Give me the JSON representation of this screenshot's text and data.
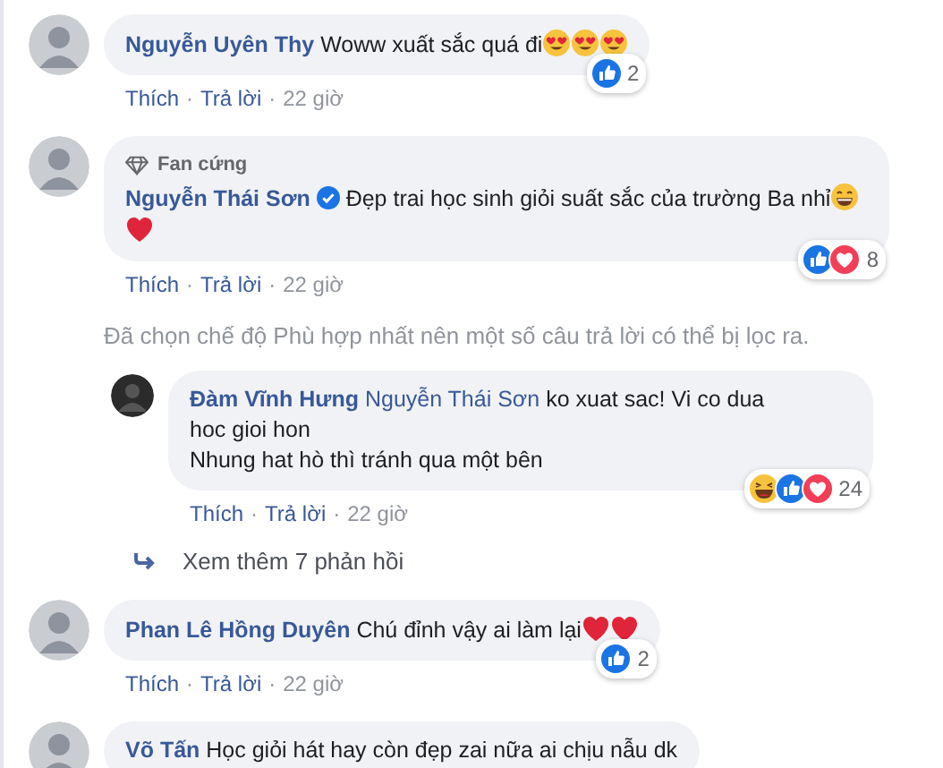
{
  "separator": "·",
  "comments": [
    {
      "name": "Nguyễn Uyên Thy",
      "verified": false,
      "text": "Woww xuất sắc quá đi",
      "emojis": [
        {
          "kind": "heart_eyes"
        },
        {
          "kind": "heart_eyes"
        },
        {
          "kind": "heart_eyes"
        }
      ],
      "reactions": {
        "kinds": [
          {
            "kind": "like"
          }
        ],
        "count": "2"
      },
      "actions": [
        "Thích",
        "Trả lời",
        "22 giờ"
      ]
    },
    {
      "name": "Nguyễn Thái Sơn",
      "badge": "Fan cứng",
      "verified": true,
      "text": "Đẹp trai học sinh giỏi suất sắc của trường Ba nhỉ",
      "emojis": [
        {
          "kind": "grin"
        },
        {
          "kind": "heart"
        }
      ],
      "reactions": {
        "kinds": [
          {
            "kind": "like"
          },
          {
            "kind": "love"
          }
        ],
        "count": "8"
      },
      "actions": [
        "Thích",
        "Trả lời",
        "22 giờ"
      ],
      "notice": "Đã chọn chế độ Phù hợp nhất nên một số câu trả lời có thể bị lọc ra.",
      "replies": [
        {
          "name": "Đàm Vĩnh Hưng",
          "mention": "Nguyễn Thái Sơn",
          "lines": [
            "ko xuat sac! Vi co dua",
            "hoc gioi hon",
            "Nhung hat hò thì tránh qua một bên"
          ],
          "reactions": {
            "kinds": [
              {
                "kind": "haha"
              },
              {
                "kind": "like"
              },
              {
                "kind": "love"
              }
            ],
            "count": "24"
          },
          "actions": [
            "Thích",
            "Trả lời",
            "22 giờ"
          ]
        }
      ],
      "more_replies": "Xem thêm 7 phản hồi"
    },
    {
      "name": "Phan Lê Hồng Duyên",
      "verified": false,
      "text": "Chú đỉnh vậy ai làm lại",
      "emojis": [
        {
          "kind": "heart"
        },
        {
          "kind": "heart"
        }
      ],
      "reactions": {
        "kinds": [
          {
            "kind": "like"
          }
        ],
        "count": "2"
      },
      "actions": [
        "Thích",
        "Trả lời",
        "22 giờ"
      ]
    },
    {
      "name": "Võ Tấn",
      "verified": false,
      "text": "Học giỏi hát hay còn đẹp zai nữa ai chịu nẫu dk"
    }
  ]
}
